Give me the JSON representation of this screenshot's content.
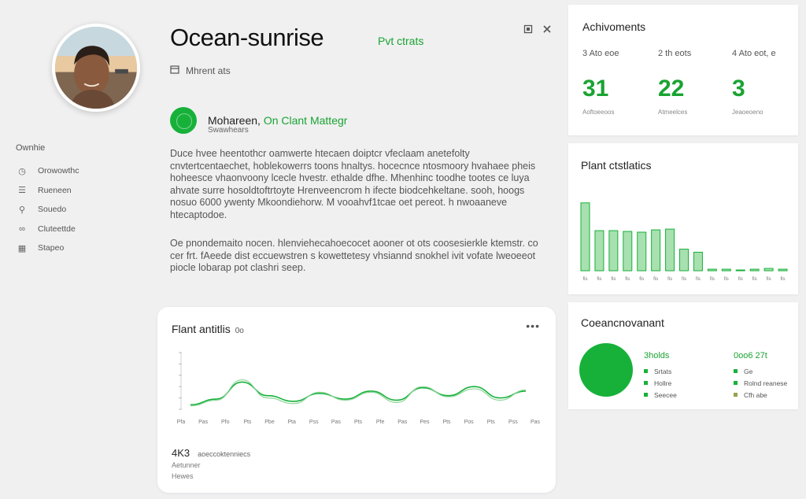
{
  "profile": {
    "title": "Ocean-sunrise",
    "tag": "Pvt ctrats",
    "meta": "Mhrent ats",
    "user_name": "Mohareen,",
    "user_name_green": "On Clant Mattegr",
    "user_sub": "Swawhears"
  },
  "window": {
    "icons": [
      "restore-icon",
      "close-icon"
    ]
  },
  "paragraphs": [
    "Duce hvee heentothcr oamwerte htecaen doiptcr vfeclaam anetefolty cnvtertcentaechet, hoblekowerrs toons hnaltys. hocecnce ntosmoory hvahaee pheis hoheesce vhaonvoony lcecle hvestr. ethalde dfhe. Mhenhinc toodhe tootes ce luya ahvate surre hosoldtoftrtoyte Hrenveencrom h ifecte biodcehkeltane. sooh, hoogs nosuo 6000 ywenty Mkoondiehorw. M vooahvf1tcae oet pereot. h nwoaaneve htecaptodoe.",
    "Oe pnondemaito nocen. hlenviehecahoecocet aooner ot ots coosesierkle ktemstr. co cer frt. fAeede dist eccuewstren s kowettetesy vhsiannd snokhel ivit vofate lweoeeot piocle lobarap pot clashri seep."
  ],
  "sidebar": {
    "heading": "Ownhie",
    "items": [
      {
        "icon": "clock-icon",
        "label": "Orowowthc"
      },
      {
        "icon": "list-icon",
        "label": "Rueneen"
      },
      {
        "icon": "pin-icon",
        "label": "Souedo"
      },
      {
        "icon": "link-icon",
        "label": "Cluteettde"
      },
      {
        "icon": "grid-icon",
        "label": "Stapeo"
      }
    ]
  },
  "line_card": {
    "title": "Flant antitlis",
    "title_suffix": "0o",
    "more": "•••",
    "stat_value": "4K3",
    "stat_note": "aoeccoktenniecs",
    "stat_sub1": "Aetunner",
    "stat_sub2": "Hewes"
  },
  "achievements": {
    "title": "Achivoments",
    "items": [
      {
        "label": "3 Ato eoe",
        "value": "31",
        "sub": "Aoftoeeoos"
      },
      {
        "label": "2 th eots",
        "value": "22",
        "sub": "Atmeelces"
      },
      {
        "label": "4 Ato eot, e",
        "value": "3",
        "sub": "Jeaoeoeno"
      }
    ]
  },
  "bar_card": {
    "title": "Plant ctstlatics"
  },
  "composition": {
    "title": "Coeancnovanant",
    "left_head": "3holds",
    "left_items": [
      "Srtats",
      "Hollre",
      "Seecee"
    ],
    "right_head": "0oo6 27t",
    "right_items": [
      "Ge",
      "Rolnd reanese",
      "Cfh abe"
    ]
  },
  "colors": {
    "accent": "#17b13a",
    "accent_text": "#1aa332",
    "accent_light": "#a8e0b0"
  },
  "chart_data": [
    {
      "type": "line",
      "title": "Flant antitlis",
      "x": [
        "Pfa",
        "Pas",
        "Pfo",
        "Pts",
        "Pbe",
        "Pta",
        "Pss",
        "Pas",
        "Pts",
        "Pfe",
        "Pas",
        "Pes",
        "Pts",
        "Pos",
        "Pts",
        "Pss",
        "Pas"
      ],
      "series": [
        {
          "values": [
            4,
            9,
            24,
            12,
            7,
            14,
            9,
            16,
            8,
            19,
            12,
            20,
            10,
            16
          ]
        },
        {
          "values": [
            3,
            8,
            26,
            10,
            5,
            15,
            8,
            15,
            6,
            20,
            11,
            18,
            8,
            17
          ]
        }
      ],
      "ylim": [
        0,
        50
      ],
      "grid": false
    },
    {
      "type": "bar",
      "title": "Plant ctstlatics",
      "categories": [
        "fis",
        "fis",
        "fis",
        "fis",
        "fis",
        "fis",
        "fis",
        "fis",
        "fis",
        "fis",
        "fis",
        "fis",
        "fis",
        "fis",
        "fis"
      ],
      "values": [
        88,
        52,
        52,
        51,
        50,
        53,
        54,
        28,
        24,
        2,
        2,
        1,
        2,
        3,
        2
      ],
      "ylim": [
        0,
        100
      ]
    },
    {
      "type": "pie",
      "title": "Coeancnovanant",
      "values": [
        100
      ]
    }
  ]
}
